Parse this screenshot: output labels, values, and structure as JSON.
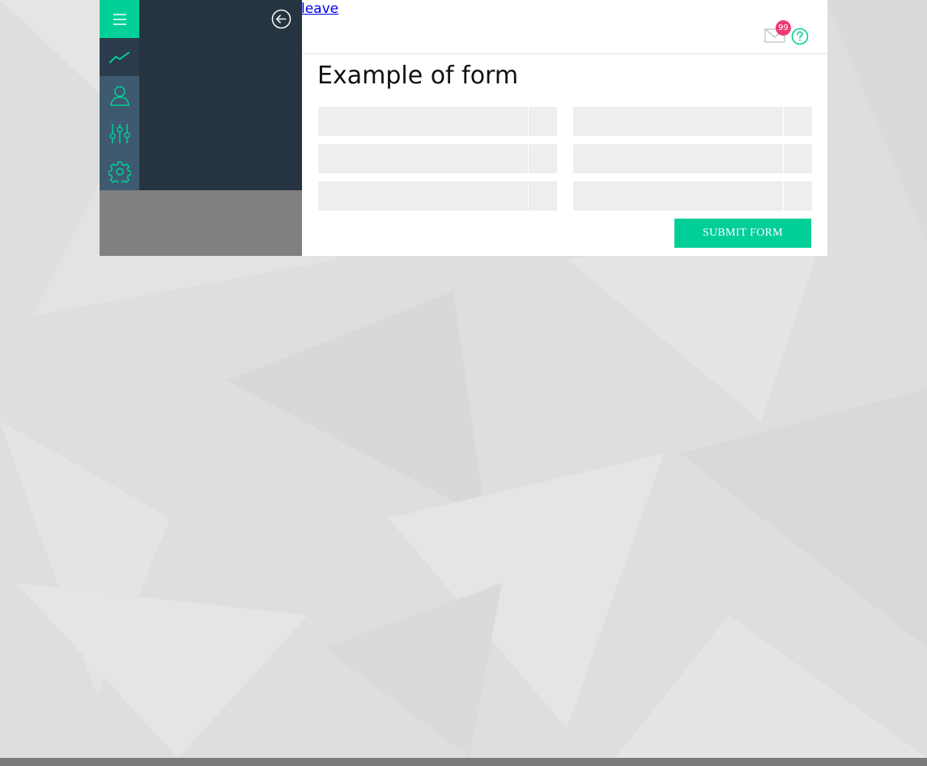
{
  "leave_link": "leave",
  "notifications": {
    "count": "99"
  },
  "form": {
    "title": "Example of form",
    "fields": [
      {
        "value": "",
        "placeholder": ""
      },
      {
        "value": "",
        "placeholder": ""
      },
      {
        "value": "",
        "placeholder": ""
      },
      {
        "value": "",
        "placeholder": ""
      },
      {
        "value": "",
        "placeholder": ""
      },
      {
        "value": "",
        "placeholder": ""
      }
    ],
    "submit_label": "SUBMIT FORM"
  },
  "colors": {
    "accent": "#00cf98",
    "sidebar": "#263441",
    "icon_rail": "#3e5a70",
    "badge": "#ee3b73",
    "field_bg": "#eeeeee"
  },
  "icons": {
    "menu": "hamburger-menu-icon",
    "rail": [
      "trend-line-icon",
      "user-icon",
      "sliders-icon",
      "gear-icon"
    ],
    "back": "arrow-left-circle-icon",
    "mail": "envelope-icon",
    "help": "question-circle-icon"
  }
}
